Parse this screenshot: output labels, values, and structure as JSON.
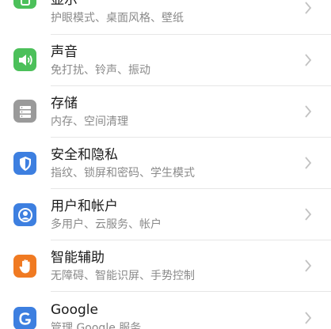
{
  "settings": {
    "items": [
      {
        "title": "显示",
        "subtitle": "护眼模式、桌面风格、壁纸",
        "icon": "display-phone-icon",
        "color": "#4cc05a"
      },
      {
        "title": "声音",
        "subtitle": "免打扰、铃声、振动",
        "icon": "speaker-icon",
        "color": "#4cc05a"
      },
      {
        "title": "存储",
        "subtitle": "内存、空间清理",
        "icon": "storage-icon",
        "color": "#9a9a9a"
      },
      {
        "title": "安全和隐私",
        "subtitle": "指纹、锁屏和密码、学生模式",
        "icon": "shield-icon",
        "color": "#3d7fe0"
      },
      {
        "title": "用户和帐户",
        "subtitle": "多用户、云服务、帐户",
        "icon": "user-account-icon",
        "color": "#3d7fe0"
      },
      {
        "title": "智能辅助",
        "subtitle": "无障碍、智能识屏、手势控制",
        "icon": "hand-icon",
        "color": "#f07a22"
      },
      {
        "title": "Google",
        "subtitle": "管理 Google 服务",
        "icon": "google-icon",
        "color": "#3d7fe0"
      }
    ]
  }
}
